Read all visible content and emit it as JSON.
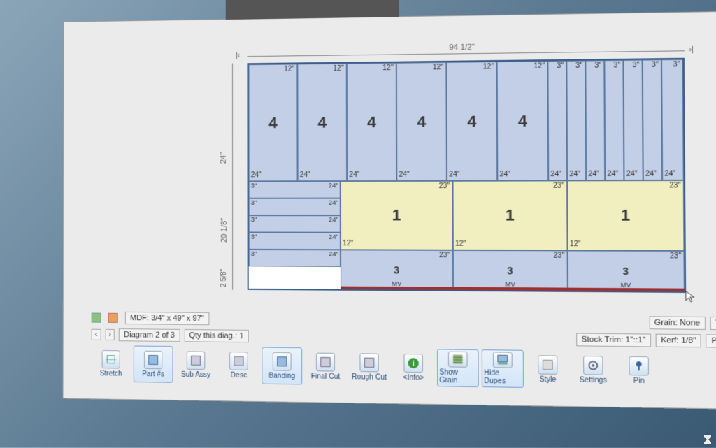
{
  "dimensions": {
    "top": "94 1/2\"",
    "left_upper": "24\"",
    "left_mid": "20 1/8\"",
    "left_low": "2 5/8\""
  },
  "pieces_top": [
    {
      "id": "4",
      "w": "12\"",
      "h": "24\""
    },
    {
      "id": "4",
      "w": "12\"",
      "h": "24\""
    },
    {
      "id": "4",
      "w": "12\"",
      "h": "24\""
    },
    {
      "id": "4",
      "w": "12\"",
      "h": "24\""
    },
    {
      "id": "4",
      "w": "12\"",
      "h": "24\""
    },
    {
      "id": "4",
      "w": "12\"",
      "h": "24\""
    }
  ],
  "narrow_top": [
    {
      "w": "3\"",
      "h": "24\""
    },
    {
      "w": "3\"",
      "h": "24\""
    },
    {
      "w": "3\"",
      "h": "24\""
    },
    {
      "w": "3\"",
      "h": "24\""
    },
    {
      "w": "3\"",
      "h": "24\""
    },
    {
      "w": "3\"",
      "h": "24\""
    },
    {
      "w": "3\"",
      "h": "24\""
    }
  ],
  "strips_left": [
    {
      "l": "3\"",
      "r": "24\""
    },
    {
      "l": "3\"",
      "r": "24\""
    },
    {
      "l": "3\"",
      "r": "24\""
    },
    {
      "l": "3\"",
      "r": "24\""
    },
    {
      "l": "3\"",
      "r": "24\""
    }
  ],
  "yellow": [
    {
      "id": "1",
      "w": "23\"",
      "h": "12\""
    },
    {
      "id": "1",
      "w": "23\"",
      "h": "12\""
    },
    {
      "id": "1",
      "w": "23\"",
      "h": "12\""
    }
  ],
  "bottom": [
    {
      "id": "3",
      "w": "23\"",
      "sub": "MV"
    },
    {
      "id": "3",
      "w": "23\"",
      "sub": "MV"
    },
    {
      "id": "3",
      "w": "23\"",
      "sub": "MV"
    }
  ],
  "status": {
    "material": "MDF: 3/4\" x 49\" x 97\"",
    "diagram": "Diagram 2 of 3",
    "qty": "Qty this diag.: 1",
    "grain": "Grain: None",
    "vend": "Vend",
    "stock_trim": "Stock Trim: 1\"::1\"",
    "kerf": "Kerf: 1/8\"",
    "partp": "Part P"
  },
  "toolbar": {
    "stretch": "Stretch",
    "parts": "Part #s",
    "subassy": "Sub Assy",
    "desc": "Desc",
    "banding": "Banding",
    "finalcut": "Final Cut",
    "roughcut": "Rough Cut",
    "info": "<Info>",
    "showgrain": "Show Grain",
    "hidedupes": "Hide Dupes",
    "style": "Style",
    "settings": "Settings",
    "pin": "Pin"
  }
}
